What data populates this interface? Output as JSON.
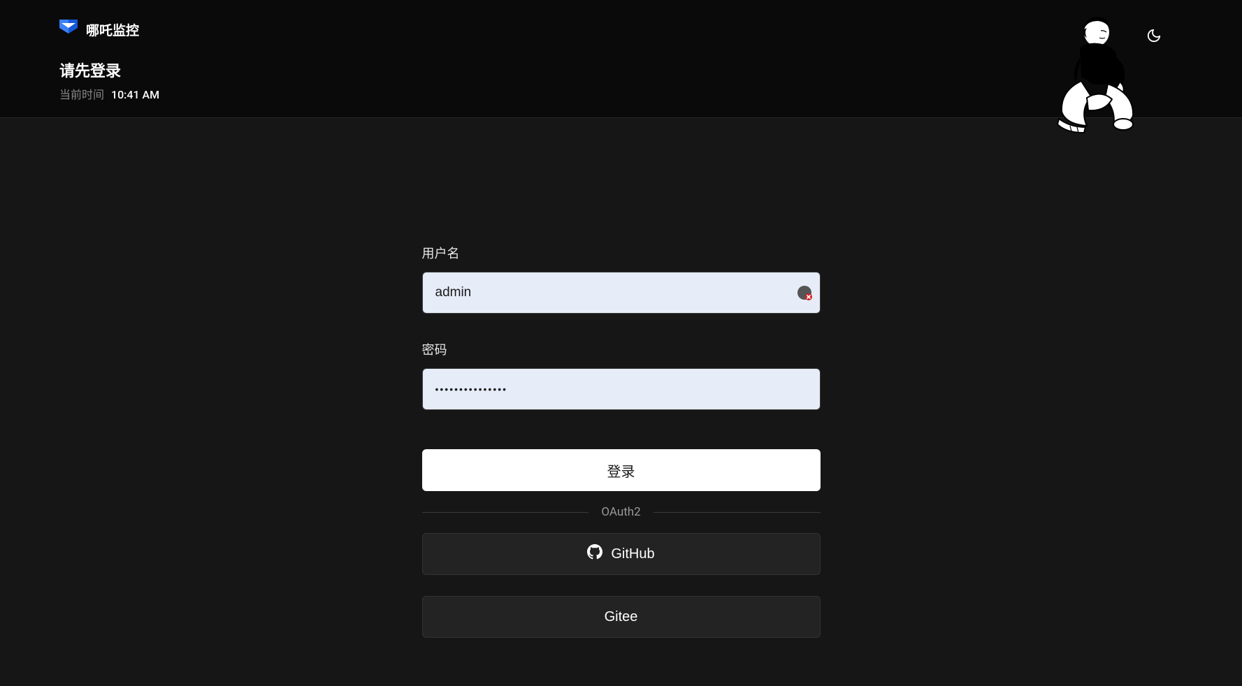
{
  "brand": {
    "name": "哪吒监控"
  },
  "header": {
    "heading": "请先登录",
    "time_label": "当前时间",
    "time_value": "10:41 AM"
  },
  "form": {
    "username_label": "用户名",
    "username_value": "admin",
    "password_label": "密码",
    "password_value": "•••••••••••••••",
    "login_button": "登录",
    "oauth_divider": "OAuth2",
    "github_button": "GitHub",
    "gitee_button": "Gitee"
  },
  "icons": {
    "theme_toggle": "moon-icon",
    "github": "github-icon",
    "logo": "nezha-logo",
    "pw_manager": "password-manager-icon"
  }
}
